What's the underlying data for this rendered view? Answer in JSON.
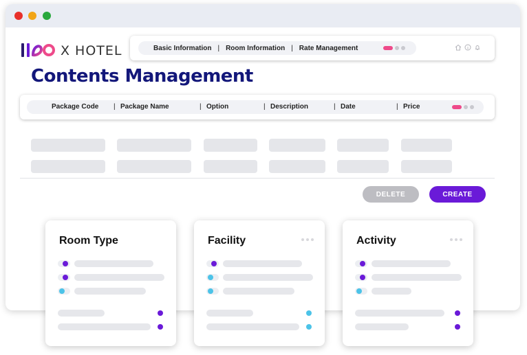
{
  "window": {
    "controls": [
      "close",
      "minimize",
      "maximize"
    ]
  },
  "brand": {
    "name": "X HOTEL",
    "logo_icon": "hotel-logo-mark"
  },
  "top_nav": {
    "items": [
      {
        "label": "Basic Information"
      },
      {
        "label": "Room Information"
      },
      {
        "label": "Rate Management"
      }
    ],
    "icons": [
      "home-icon",
      "info-icon",
      "bell-icon"
    ]
  },
  "page": {
    "title": "Contents Management"
  },
  "table": {
    "columns": [
      "Package Code",
      "Package Name",
      "Option",
      "Description",
      "Date",
      "Price"
    ]
  },
  "actions": {
    "delete_label": "DELETE",
    "create_label": "CREATE"
  },
  "cards": [
    {
      "title": "Room Type"
    },
    {
      "title": "Facility"
    },
    {
      "title": "Activity"
    }
  ],
  "colors": {
    "accent": "#6a1ad8",
    "title": "#13177a",
    "toggle_active": "#ee4a8a",
    "secondary_dot": "#4cc3e8",
    "disabled_button": "#bdbdc2"
  }
}
